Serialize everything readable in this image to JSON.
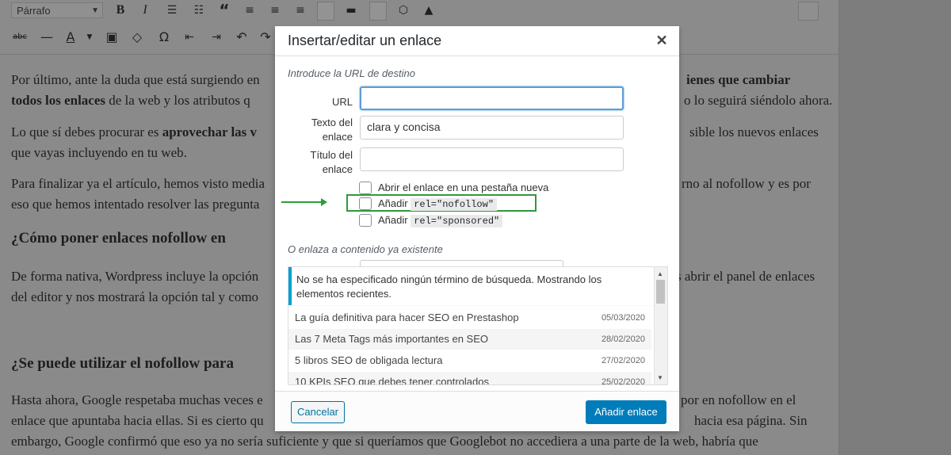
{
  "toolbar": {
    "format_select": "Párrafo",
    "icons_row1": [
      "bold-icon",
      "italic-icon",
      "bullet-list-icon",
      "numbered-list-icon",
      "blockquote-icon",
      "align-left-icon",
      "align-center-icon",
      "align-right-icon"
    ],
    "icons_row2": [
      "strikethrough-icon",
      "horizontal-line-icon",
      "text-color-icon",
      "paste-text-icon",
      "clear-formatting-icon",
      "special-character-icon",
      "outdent-icon",
      "indent-icon",
      "undo-icon",
      "redo-icon"
    ]
  },
  "content": {
    "para1_line1_a": "Por último, ante la duda que está surgiendo en",
    "para1_line1_b": "ienes que cambiar",
    "para1_line2_a": "todos los enlaces",
    "para1_line2_b": " de la web y los atributos q",
    "para1_line2_c": "o lo seguirá siéndolo ahora.",
    "para2_line1_a": "Lo que sí debes procurar es ",
    "para2_line1_b": "aprovechar las v",
    "para2_line1_c": "sible los nuevos enlaces",
    "para2_line2": "que vayas incluyendo en tu web.",
    "para3_line1_a": "Para finalizar ya el artículo, hemos visto media",
    "para3_line1_b": "rno al nofollow y es por",
    "para3_line2": "eso que hemos intentado resolver las pregunta",
    "heading1": "¿Cómo poner enlaces nofollow en",
    "para4_line1_a": "De forma nativa, Wordpress incluye la opción",
    "para4_line1_b": "s abrir el panel de enlaces",
    "para4_line2": "del editor y nos mostrará la opción tal y como",
    "heading2": "¿Se puede utilizar el nofollow para",
    "para5_line1_a": "Hasta ahora, Google respetaba muchas veces e",
    "para5_line1_b": "por en nofollow en el",
    "para5_line2_a": "enlace que apuntaba hacia ellas. Si es cierto qu",
    "para5_line2_b": "hacia esa página. Sin",
    "para5_line3": "embargo, Google confirmó que eso ya no sería suficiente y que si queríamos que Googlebot no accediera a una parte de la web, habría que"
  },
  "modal": {
    "title": "Insertar/editar un enlace",
    "close_icon": "close-icon",
    "url_section_label": "Introduce la URL de destino",
    "url_label": "URL",
    "url_value": "",
    "text_label_1": "Texto del",
    "text_label_2": "enlace",
    "text_value": "clara y concisa",
    "title_label_1": "Título del",
    "title_label_2": "enlace",
    "title_value": "",
    "opt_new_tab": "Abrir el enlace en una pestaña nueva",
    "opt_nofollow_prefix": "Añadir",
    "opt_nofollow_code": "rel=\"nofollow\"",
    "opt_sponsored_prefix": "Añadir",
    "opt_sponsored_code": "rel=\"sponsored\"",
    "existing_label": "O enlaza a contenido ya existente",
    "notice": "No se ha especificado ningún término de búsqueda. Mostrando los elementos recientes.",
    "results": [
      {
        "title": "La guía definitiva para hacer SEO en Prestashop",
        "date": "05/03/2020"
      },
      {
        "title": "Las 7 Meta Tags más importantes en SEO",
        "date": "28/02/2020"
      },
      {
        "title": "5 libros SEO de obligada lectura",
        "date": "27/02/2020"
      },
      {
        "title": "10 KPIs SEO que debes tener controlados",
        "date": "25/02/2020"
      }
    ],
    "cancel_label": "Cancelar",
    "submit_label": "Añadir enlace"
  },
  "colors": {
    "accent": "#007cba",
    "highlight": "#2f9a3b",
    "notice_bar": "#00a0d2"
  }
}
